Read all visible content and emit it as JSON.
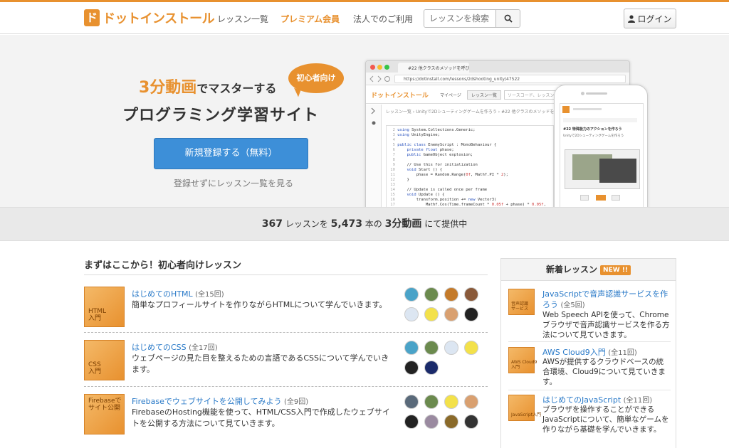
{
  "brand": {
    "logo_mark": "ド",
    "logo_text": "ドットインストール",
    "accent": "#e8912f"
  },
  "nav": {
    "lessons": "レッスン一覧",
    "premium": "プレミアム会員",
    "corporate": "法人でのご利用"
  },
  "search": {
    "placeholder": "レッスンを検索",
    "icon": "search-icon"
  },
  "login": {
    "label": "ログイン",
    "icon": "user-icon"
  },
  "hero": {
    "line1_highlight": "3分動画",
    "line1_rest": "でマスターする",
    "line2": "プログラミング学習サイト",
    "badge": "初心者向け",
    "signup_button": "新規登録する（無料）",
    "browse_link": "登録せずにレッスン一覧を見る"
  },
  "mock_browser": {
    "tab_title": "#22 他クラスのメソッドを呼び出...",
    "url": "https://dotinstall.com/lessons/2dshooting_unity/47522",
    "site_logo": "ドットインストール",
    "nav_mypage": "マイページ",
    "nav_lessons": "レッスン一覧",
    "search_placeholder": "ソースコード、レッスンを検索",
    "breadcrumb": "レッスン一覧 › Unityで2Dシューティングゲームを作ろう › #22 他クラスのメソッドを呼び出す"
  },
  "mock_phone": {
    "title": "#22 特殊能力のアクションを作ろう",
    "subtitle": "Unityで2Dシューティングゲームを作ろう"
  },
  "stats": {
    "lessons_count": "367",
    "lessons_label": "レッスンを",
    "videos_count": "5,473",
    "videos_label": "本の",
    "videos_highlight": "3分動画",
    "suffix": "にて提供中"
  },
  "beginner": {
    "title": "まずはここから！初心者向けレッスン",
    "lessons": [
      {
        "thumb_label": "HTML\n入門",
        "title": "はじめてのHTML",
        "count": "(全15回)",
        "desc": "簡単なプロフィールサイトを作りながらHTMLについて学んでいきます。"
      },
      {
        "thumb_label": "CSS\n入門",
        "title": "はじめてのCSS",
        "count": "(全17回)",
        "desc": "ウェブページの見た目を整えるための言語であるCSSについて学んでいきます。"
      },
      {
        "thumb_label": "Firebaseで\nサイト公開",
        "title": "Firebaseでウェブサイトを公開してみよう",
        "count": "(全9回)",
        "desc": "FirebaseのHosting機能を使って、HTML/CSS入門で作成したウェブサイトを公開する方法について見ていきます。"
      }
    ]
  },
  "new_lessons": {
    "title": "新着レッスン",
    "badge": "NEW !!",
    "items": [
      {
        "thumb_label": "音声認識\nサービス",
        "title": "JavaScriptで音声認識サービスを作ろう",
        "count": "(全5回)",
        "desc": "Web Speech APIを使って、Chromeブラウザで音声認識サービスを作る方法について見ていきます。"
      },
      {
        "thumb_label": "AWS Cloud9\n入門",
        "title": "AWS Cloud9入門",
        "count": "(全11回)",
        "desc": "AWSが提供するクラウドベースの統合環境、Cloud9について見ていきます。"
      },
      {
        "thumb_label": "JavaScript入門",
        "title": "はじめてのJavaScript",
        "count": "(全11回)",
        "desc": "ブラウザを操作することができるJavaScriptについて、簡単なゲームを作りながら基礎を学んでいきます。"
      }
    ]
  }
}
